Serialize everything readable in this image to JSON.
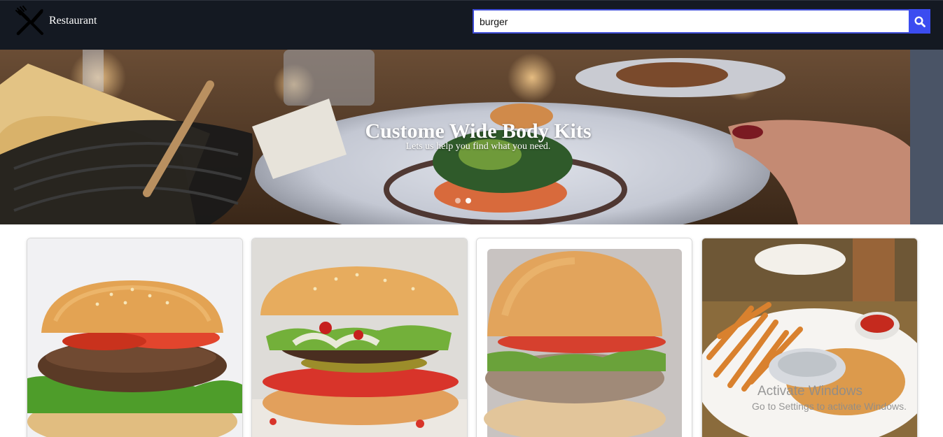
{
  "navbar": {
    "brand": {
      "name": "Restaurant",
      "icon": "fork-knife-icon"
    },
    "search": {
      "value": "burger",
      "placeholder": "",
      "button_icon": "search-icon"
    },
    "colors": {
      "background": "#141922",
      "accent": "#3b4cf0"
    }
  },
  "hero": {
    "title": "Custome Wide Body Kits",
    "subtitle": "Lets us help you find what you need.",
    "carousel": {
      "total_slides": 2,
      "active_slide": 2
    }
  },
  "cards": [
    {
      "image": "burger-white-background-photo"
    },
    {
      "image": "burger-with-pickles-photo"
    },
    {
      "image": "classic-burger-photo"
    },
    {
      "image": "burger-and-fries-plate-photo"
    }
  ],
  "os_watermark": {
    "line1": "Activate Windows",
    "line2": "Go to Settings to activate Windows."
  }
}
